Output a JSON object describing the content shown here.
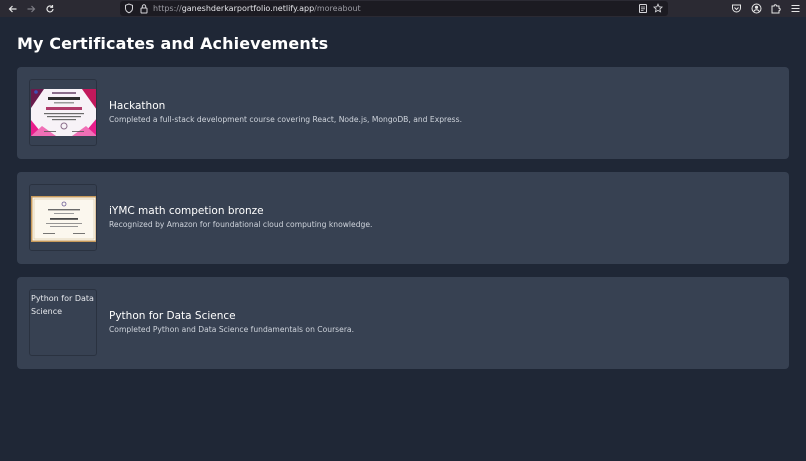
{
  "browser": {
    "url_prefix": "https://",
    "url_host": "ganeshderkarportfolio.netlify.app",
    "url_path": "/moreabout",
    "icons": [
      "back-arrow-icon",
      "forward-arrow-icon",
      "reload-icon",
      "shield-icon",
      "lock-icon",
      "reader-view-icon",
      "bookmark-star-icon",
      "pocket-icon",
      "account-icon",
      "extensions-icon",
      "menu-icon"
    ]
  },
  "page": {
    "title": "My Certificates and Achievements"
  },
  "certificates": [
    {
      "title": "Hackathon",
      "description": "Completed a full-stack development course covering React, Node.js, MongoDB, and Express.",
      "thumbnail": "certificate-image-pink"
    },
    {
      "title": "iYMC math competion bronze",
      "description": "Recognized by Amazon for foundational cloud computing knowledge.",
      "thumbnail": "certificate-image-cream"
    },
    {
      "title": "Python for Data Science",
      "description": "Completed Python and Data Science fundamentals on Coursera.",
      "thumbnail_alt": "Python for Data Science"
    }
  ],
  "colors": {
    "background": "#1f2736",
    "card": "#374152",
    "toolbar": "#2b2a33"
  }
}
